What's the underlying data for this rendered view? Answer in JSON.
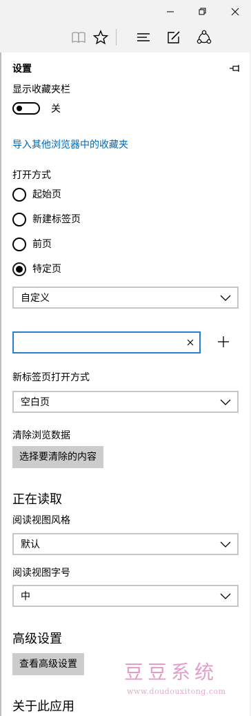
{
  "window": {
    "controls": [
      "minimize-icon",
      "restore-icon",
      "close-icon"
    ]
  },
  "toolbar": {
    "icons": [
      "reading-view-icon",
      "favorite-star-icon",
      "hub-icon",
      "web-note-icon",
      "share-icon"
    ]
  },
  "panel": {
    "title": "设置",
    "pin_icon": "pin-icon",
    "favorites_bar": {
      "label": "显示收藏夹栏",
      "toggle_state": "关",
      "toggle_on": false
    },
    "import_link": "导入其他浏览器中的收藏夹",
    "open_with": {
      "label": "打开方式",
      "options": [
        {
          "label": "起始页",
          "selected": false
        },
        {
          "label": "新建标签页",
          "selected": false
        },
        {
          "label": "前页",
          "selected": false
        },
        {
          "label": "特定页",
          "selected": true
        }
      ],
      "dropdown_value": "自定义",
      "url_input_value": "",
      "add_icon": "plus-icon",
      "clear_icon": "close-icon"
    },
    "new_tab": {
      "label": "新标签页打开方式",
      "value": "空白页"
    },
    "clear_data": {
      "label": "清除浏览数据",
      "button": "选择要清除的内容"
    },
    "reading": {
      "heading": "正在读取",
      "style_label": "阅读视图风格",
      "style_value": "默认",
      "font_label": "阅读视图字号",
      "font_value": "中"
    },
    "advanced": {
      "heading": "高级设置",
      "button": "查看高级设置"
    },
    "about": {
      "heading": "关于此应用"
    }
  },
  "watermark": {
    "title": "豆豆系统",
    "url": "www.doudouxitong.com"
  },
  "colors": {
    "accent": "#0067b8",
    "focus_border": "#2b7bd0",
    "button_bg": "#cccccc",
    "chrome_bg": "#f2f2f2"
  }
}
